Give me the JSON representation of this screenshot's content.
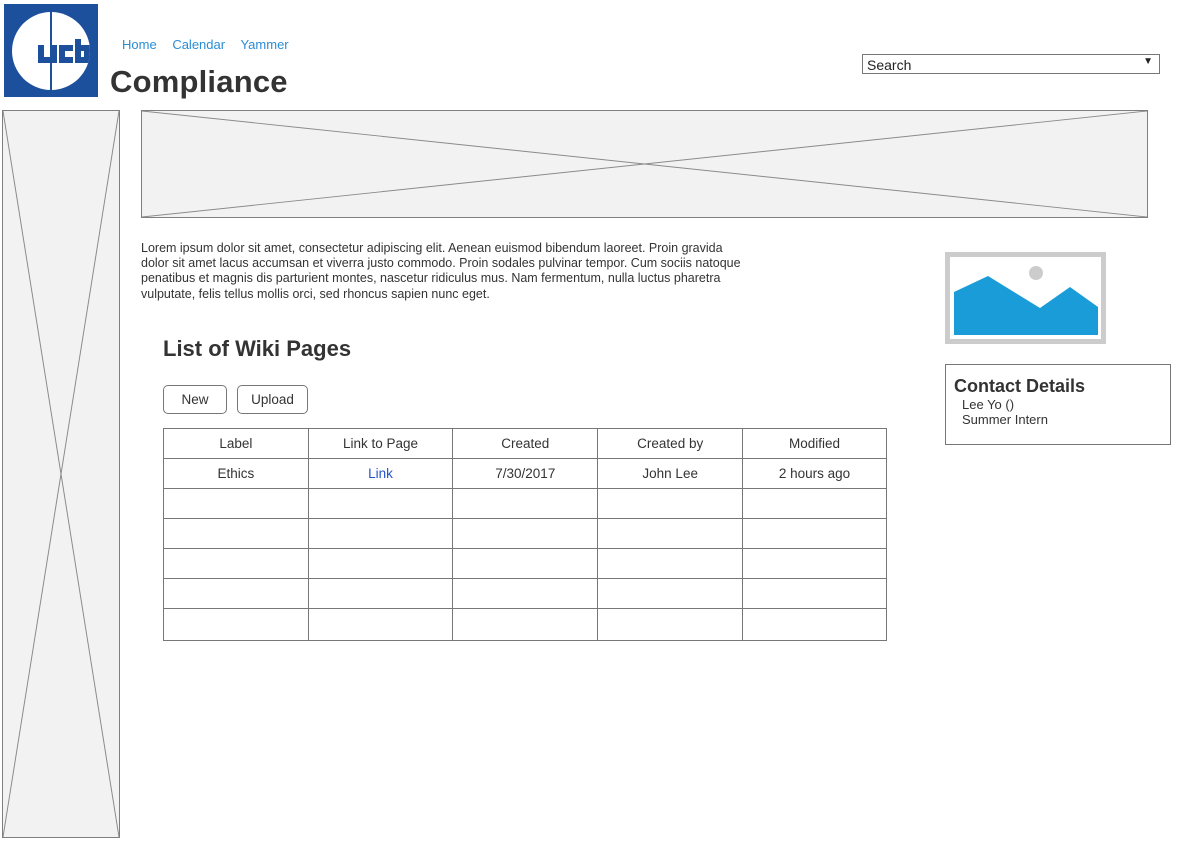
{
  "header": {
    "nav": [
      "Home",
      "Calendar",
      "Yammer"
    ],
    "title": "Compliance",
    "search": {
      "value": "Search"
    }
  },
  "intro_text": "Lorem ipsum dolor sit amet, consectetur adipiscing elit. Aenean euismod bibendum laoreet. Proin gravida dolor sit amet lacus accumsan et viverra justo commodo. Proin sodales pulvinar tempor. Cum sociis natoque penatibus et magnis dis parturient montes, nascetur ridiculus mus. Nam fermentum, nulla luctus pharetra vulputate, felis tellus mollis orci, sed rhoncus sapien nunc eget.",
  "list": {
    "heading": "List of Wiki Pages",
    "buttons": {
      "new": "New",
      "upload": "Upload"
    },
    "columns": [
      "Label",
      "Link to Page",
      "Created",
      "Created by",
      "Modified"
    ],
    "rows": [
      [
        "Ethics",
        "Link",
        "7/30/2017",
        "John Lee",
        "2 hours ago"
      ]
    ]
  },
  "contact": {
    "heading": "Contact Details",
    "name": "Lee Yo ()",
    "role": "Summer Intern"
  },
  "colors": {
    "logo_blue": "#1c4f9c",
    "link_blue": "#2a8dd4",
    "image_blue": "#1a9cd8"
  }
}
